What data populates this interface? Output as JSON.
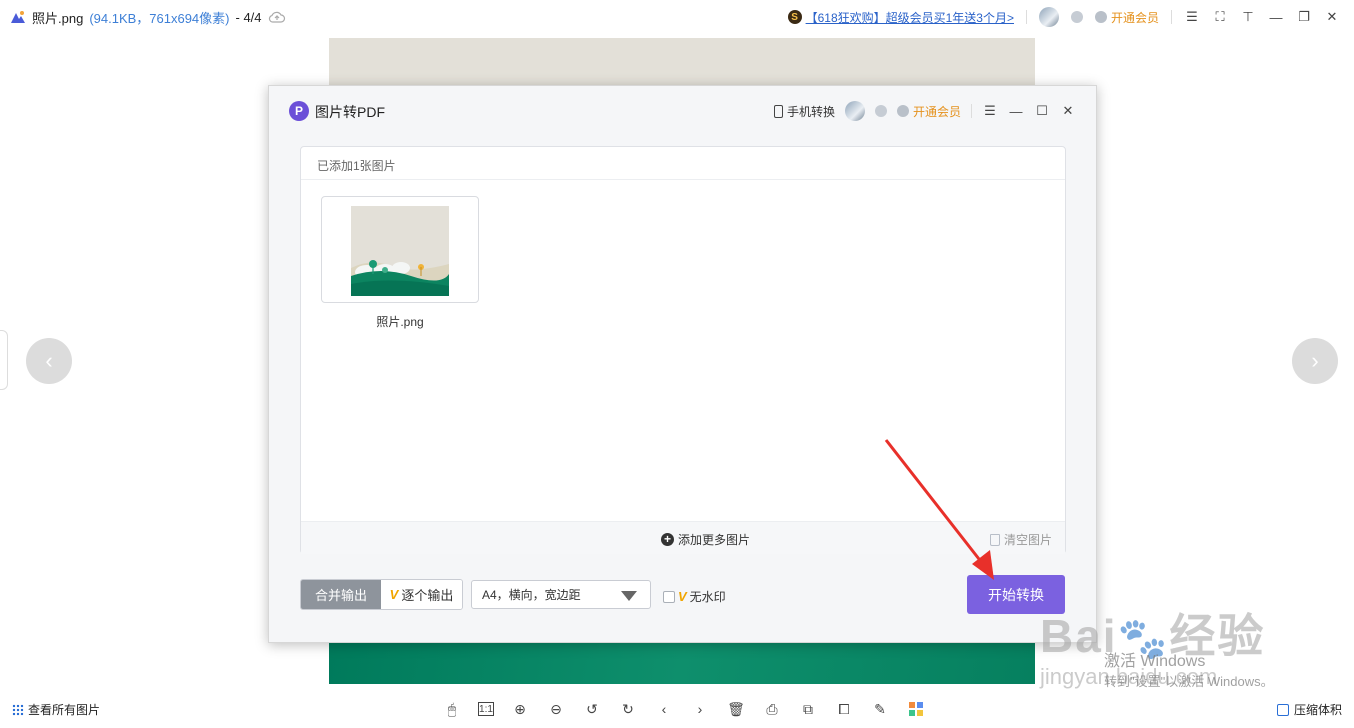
{
  "titlebar": {
    "filename": "照片.png",
    "meta": "(94.1KB，761x694像素)",
    "page_indicator": "- 4/4",
    "promo_badge": "S",
    "promo_text": "【618狂欢购】超级会员买1年送3个月>",
    "vip_label": "开通会员"
  },
  "dialog": {
    "logo_letter": "P",
    "title": "图片转PDF",
    "phone_convert": "手机转换",
    "vip_label": "开通会员",
    "panel": {
      "count_label": "已添加1张图片",
      "images": [
        {
          "name": "照片.png"
        }
      ],
      "add_more": "添加更多图片",
      "clear": "清空图片"
    },
    "output": {
      "merge_label": "合并输出",
      "single_label": "逐个输出",
      "v_mark": "V",
      "page_setting": "A4，横向，宽边距",
      "watermark_label": "无水印",
      "start_label": "开始转换"
    }
  },
  "statusbar": {
    "view_all": "查看所有图片",
    "zoom_1to1": "1:1",
    "compress": "压缩体积"
  },
  "overlay": {
    "baidu": "Bai",
    "baidu2": "经验",
    "jingyan": "jingyan.baidu.com",
    "activate1": "激活 Windows",
    "activate2": "转到\"设置\"以激活 Windows。"
  },
  "colors": {
    "accent": "#7b61e0",
    "vip": "#e5921e",
    "link": "#2a62c9",
    "arrow": "#e8302a"
  }
}
